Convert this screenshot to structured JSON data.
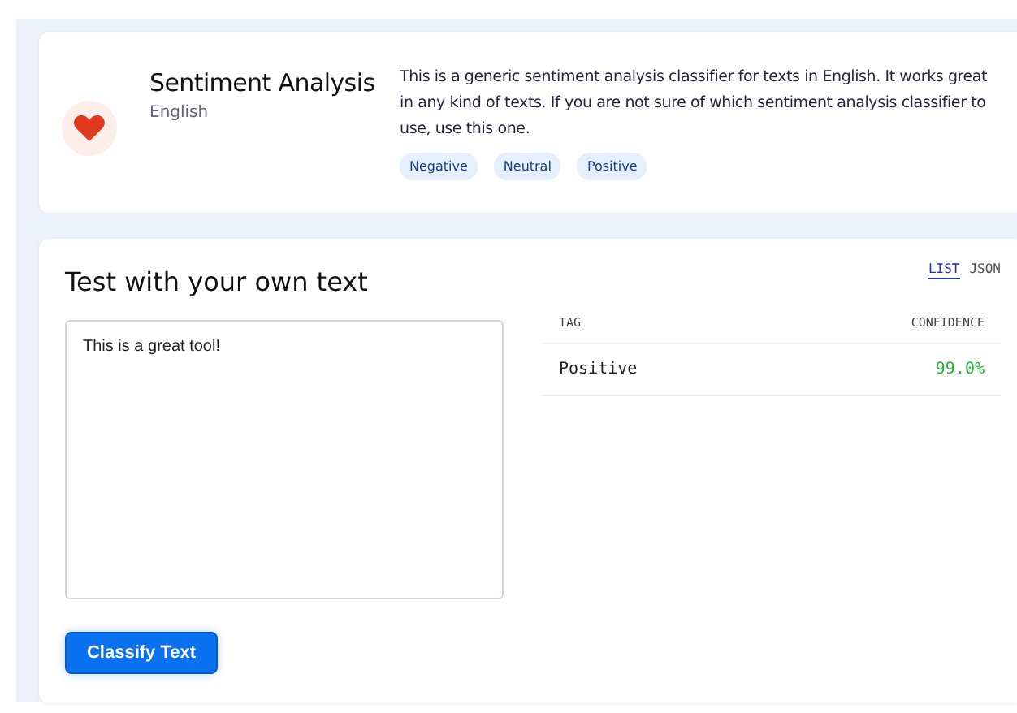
{
  "model": {
    "name": "Sentiment Analysis",
    "language": "English",
    "description": "This is a generic sentiment analysis classifier for texts in English. It works great in any kind of texts. If you are not sure of which sentiment analysis classifier to use, use this one.",
    "tags": [
      "Negative",
      "Neutral",
      "Positive"
    ]
  },
  "test": {
    "title": "Test with your own text",
    "input": "This is a great tool!",
    "button": "Classify Text",
    "views": [
      {
        "label": "LIST",
        "selected": true
      },
      {
        "label": "JSON",
        "selected": false
      }
    ],
    "columns": [
      "TAG",
      "CONFIDENCE"
    ],
    "rows": [
      {
        "tag": "Positive",
        "confidence": "99.0%"
      }
    ]
  }
}
